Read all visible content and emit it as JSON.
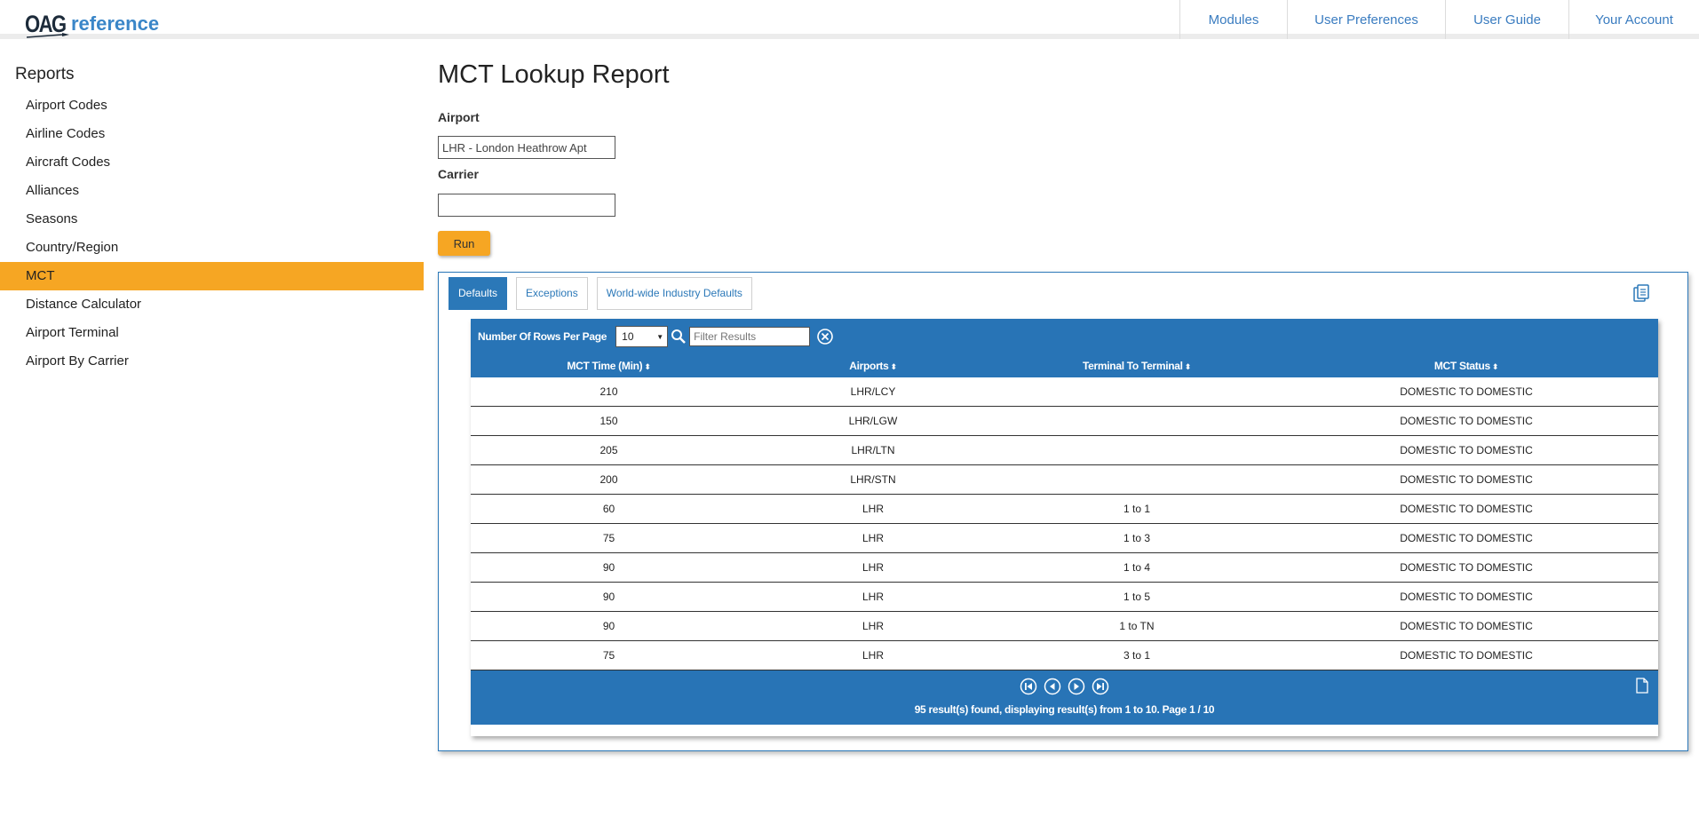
{
  "header": {
    "logo_main": "OAG",
    "logo_sub": "reference",
    "nav": [
      "Modules",
      "User Preferences",
      "User Guide",
      "Your Account"
    ]
  },
  "sidebar": {
    "title": "Reports",
    "items": [
      {
        "label": "Airport Codes"
      },
      {
        "label": "Airline Codes"
      },
      {
        "label": "Aircraft Codes"
      },
      {
        "label": "Alliances"
      },
      {
        "label": "Seasons"
      },
      {
        "label": "Country/Region"
      },
      {
        "label": "MCT",
        "active": true
      },
      {
        "label": "Distance Calculator"
      },
      {
        "label": "Airport Terminal"
      },
      {
        "label": "Airport By Carrier"
      }
    ]
  },
  "main": {
    "title": "MCT Lookup Report",
    "airport_label": "Airport",
    "airport_value": "LHR - London Heathrow Apt",
    "carrier_label": "Carrier",
    "carrier_value": "",
    "run_label": "Run"
  },
  "tabs": [
    {
      "label": "Defaults",
      "active": true
    },
    {
      "label": "Exceptions"
    },
    {
      "label": "World-wide Industry Defaults"
    }
  ],
  "grid": {
    "rows_per_page_label": "Number Of Rows Per Page",
    "rows_per_page_value": "10",
    "filter_placeholder": "Filter Results",
    "columns": [
      "MCT Time (Min)",
      "Airports",
      "Terminal To Terminal",
      "MCT Status"
    ],
    "rows": [
      [
        "210",
        "LHR/LCY",
        "",
        "DOMESTIC TO DOMESTIC"
      ],
      [
        "150",
        "LHR/LGW",
        "",
        "DOMESTIC TO DOMESTIC"
      ],
      [
        "205",
        "LHR/LTN",
        "",
        "DOMESTIC TO DOMESTIC"
      ],
      [
        "200",
        "LHR/STN",
        "",
        "DOMESTIC TO DOMESTIC"
      ],
      [
        "60",
        "LHR",
        "1 to 1",
        "DOMESTIC TO DOMESTIC"
      ],
      [
        "75",
        "LHR",
        "1 to 3",
        "DOMESTIC TO DOMESTIC"
      ],
      [
        "90",
        "LHR",
        "1 to 4",
        "DOMESTIC TO DOMESTIC"
      ],
      [
        "90",
        "LHR",
        "1 to 5",
        "DOMESTIC TO DOMESTIC"
      ],
      [
        "90",
        "LHR",
        "1 to TN",
        "DOMESTIC TO DOMESTIC"
      ],
      [
        "75",
        "LHR",
        "3 to 1",
        "DOMESTIC TO DOMESTIC"
      ]
    ],
    "footer_text": "95 result(s) found, displaying result(s) from 1 to 10. Page 1 / 10"
  },
  "colors": {
    "accent": "#f6a623",
    "grid_blue": "#2874b6",
    "link_blue": "#3a7cc0"
  },
  "icons": [
    "search-icon",
    "clear-filter-icon",
    "first-page-icon",
    "prev-page-icon",
    "next-page-icon",
    "last-page-icon",
    "export-icon",
    "document-icon"
  ]
}
